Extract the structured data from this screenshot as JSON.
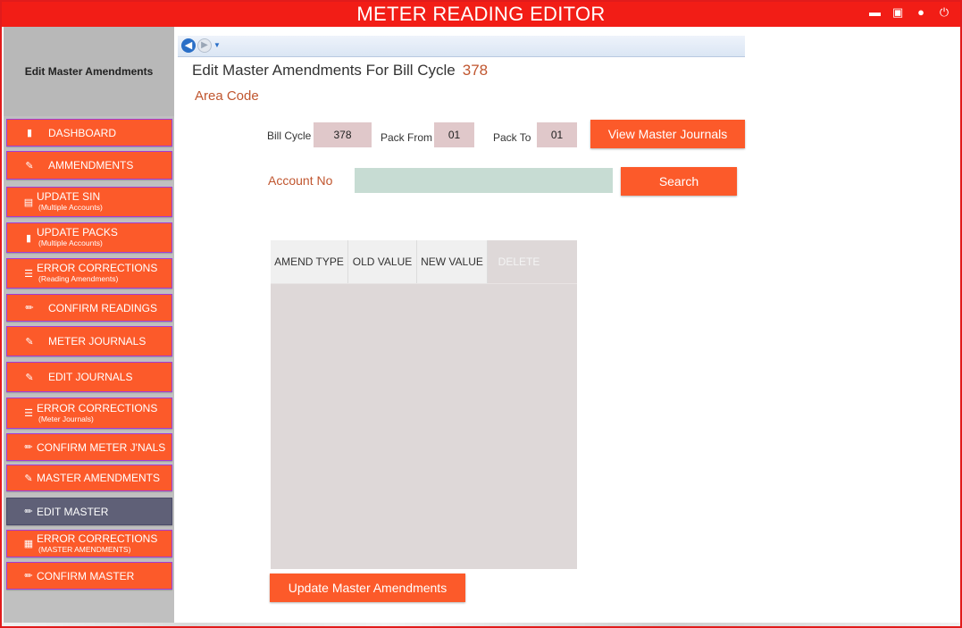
{
  "app": {
    "title": "METER READING EDITOR",
    "window_controls": [
      "minimize-icon",
      "maximize-icon",
      "user-icon",
      "power-icon"
    ]
  },
  "sidebar": {
    "header": "Edit Master Amendments",
    "items": [
      {
        "label": "DASHBOARD",
        "sub": "",
        "icon": "bookmark-icon",
        "active": false
      },
      {
        "label": "AMMENDMENTS",
        "sub": "",
        "icon": "user-edit-icon",
        "active": false
      },
      {
        "label": "UPDATE SIN",
        "sub": "(Multiple Accounts)",
        "icon": "document-icon",
        "active": false
      },
      {
        "label": "UPDATE PACKS",
        "sub": "(Multiple Accounts)",
        "icon": "bookmark-icon",
        "active": false
      },
      {
        "label": "ERROR CORRECTIONS",
        "sub": "(Reading Amendments)",
        "icon": "list-icon",
        "active": false
      },
      {
        "label": "CONFIRM READINGS",
        "sub": "",
        "icon": "pencil-icon",
        "active": false
      },
      {
        "label": "METER JOURNALS",
        "sub": "",
        "icon": "user-edit-icon",
        "active": false
      },
      {
        "label": "EDIT JOURNALS",
        "sub": "",
        "icon": "user-edit-icon",
        "active": false
      },
      {
        "label": "ERROR CORRECTIONS",
        "sub": "(Meter Journals)",
        "icon": "list-icon",
        "active": false
      },
      {
        "label": "CONFIRM METER J'NALS",
        "sub": "",
        "icon": "pencil-icon",
        "active": false
      },
      {
        "label": "MASTER AMENDMENTS",
        "sub": "",
        "icon": "user-edit-icon",
        "active": false
      },
      {
        "label": "EDIT MASTER",
        "sub": "",
        "icon": "pencil-icon",
        "active": true
      },
      {
        "label": "ERROR CORRECTIONS",
        "sub": "(MASTER AMENDMENTS)",
        "icon": "image-list-icon",
        "active": false
      },
      {
        "label": "CONFIRM MASTER",
        "sub": "",
        "icon": "pencil-icon",
        "active": false
      }
    ]
  },
  "main": {
    "title": "Edit Master Amendments For Bill Cycle",
    "bill_cycle_value": "378",
    "area_code_label": "Area Code",
    "filters": {
      "bill_cycle_label": "Bill Cycle",
      "bill_cycle": "378",
      "pack_from_label": "Pack From",
      "pack_from": "01",
      "pack_to_label": "Pack To",
      "pack_to": "01"
    },
    "view_button": "View Master Journals",
    "account_label": "Account No",
    "account_value": "",
    "search_button": "Search",
    "table": {
      "columns": [
        "AMEND TYPE",
        "OLD VALUE",
        "NEW VALUE",
        "DELETE"
      ],
      "rows": []
    },
    "update_button": "Update Master Amendments"
  },
  "colors": {
    "titlebar": "#f21d16",
    "accent": "#fc5a2a",
    "active_item": "#5f6077",
    "highlight_text": "#c0562f"
  }
}
